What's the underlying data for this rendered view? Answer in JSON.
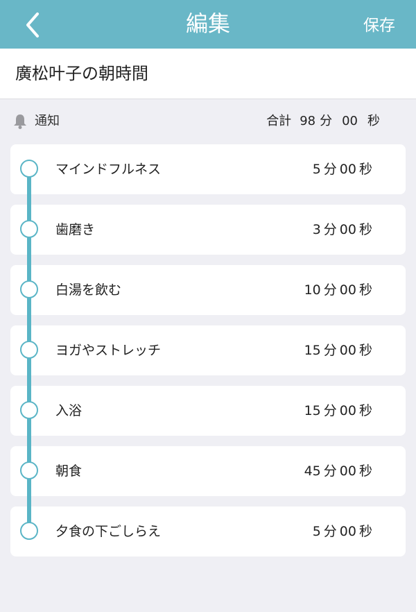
{
  "header": {
    "title": "編集",
    "save_label": "保存",
    "back_icon": "chevron-left-icon"
  },
  "routine": {
    "name": "廣松叶子の朝時間"
  },
  "notification": {
    "icon": "bell-icon",
    "label": "通知",
    "total_label": "合計",
    "total_minutes": "98",
    "minute_unit": "分",
    "total_seconds": "00",
    "second_unit": "秒"
  },
  "accent_color": "#69b7c7",
  "items": [
    {
      "label": "マインドフルネス",
      "minutes": "5",
      "seconds": "00"
    },
    {
      "label": "歯磨き",
      "minutes": "3",
      "seconds": "00"
    },
    {
      "label": "白湯を飲む",
      "minutes": "10",
      "seconds": "00"
    },
    {
      "label": "ヨガやストレッチ",
      "minutes": "15",
      "seconds": "00"
    },
    {
      "label": "入浴",
      "minutes": "15",
      "seconds": "00"
    },
    {
      "label": "朝食",
      "minutes": "45",
      "seconds": "00"
    },
    {
      "label": "夕食の下ごしらえ",
      "minutes": "5",
      "seconds": "00"
    }
  ],
  "units": {
    "minute": "分",
    "second": "秒"
  }
}
